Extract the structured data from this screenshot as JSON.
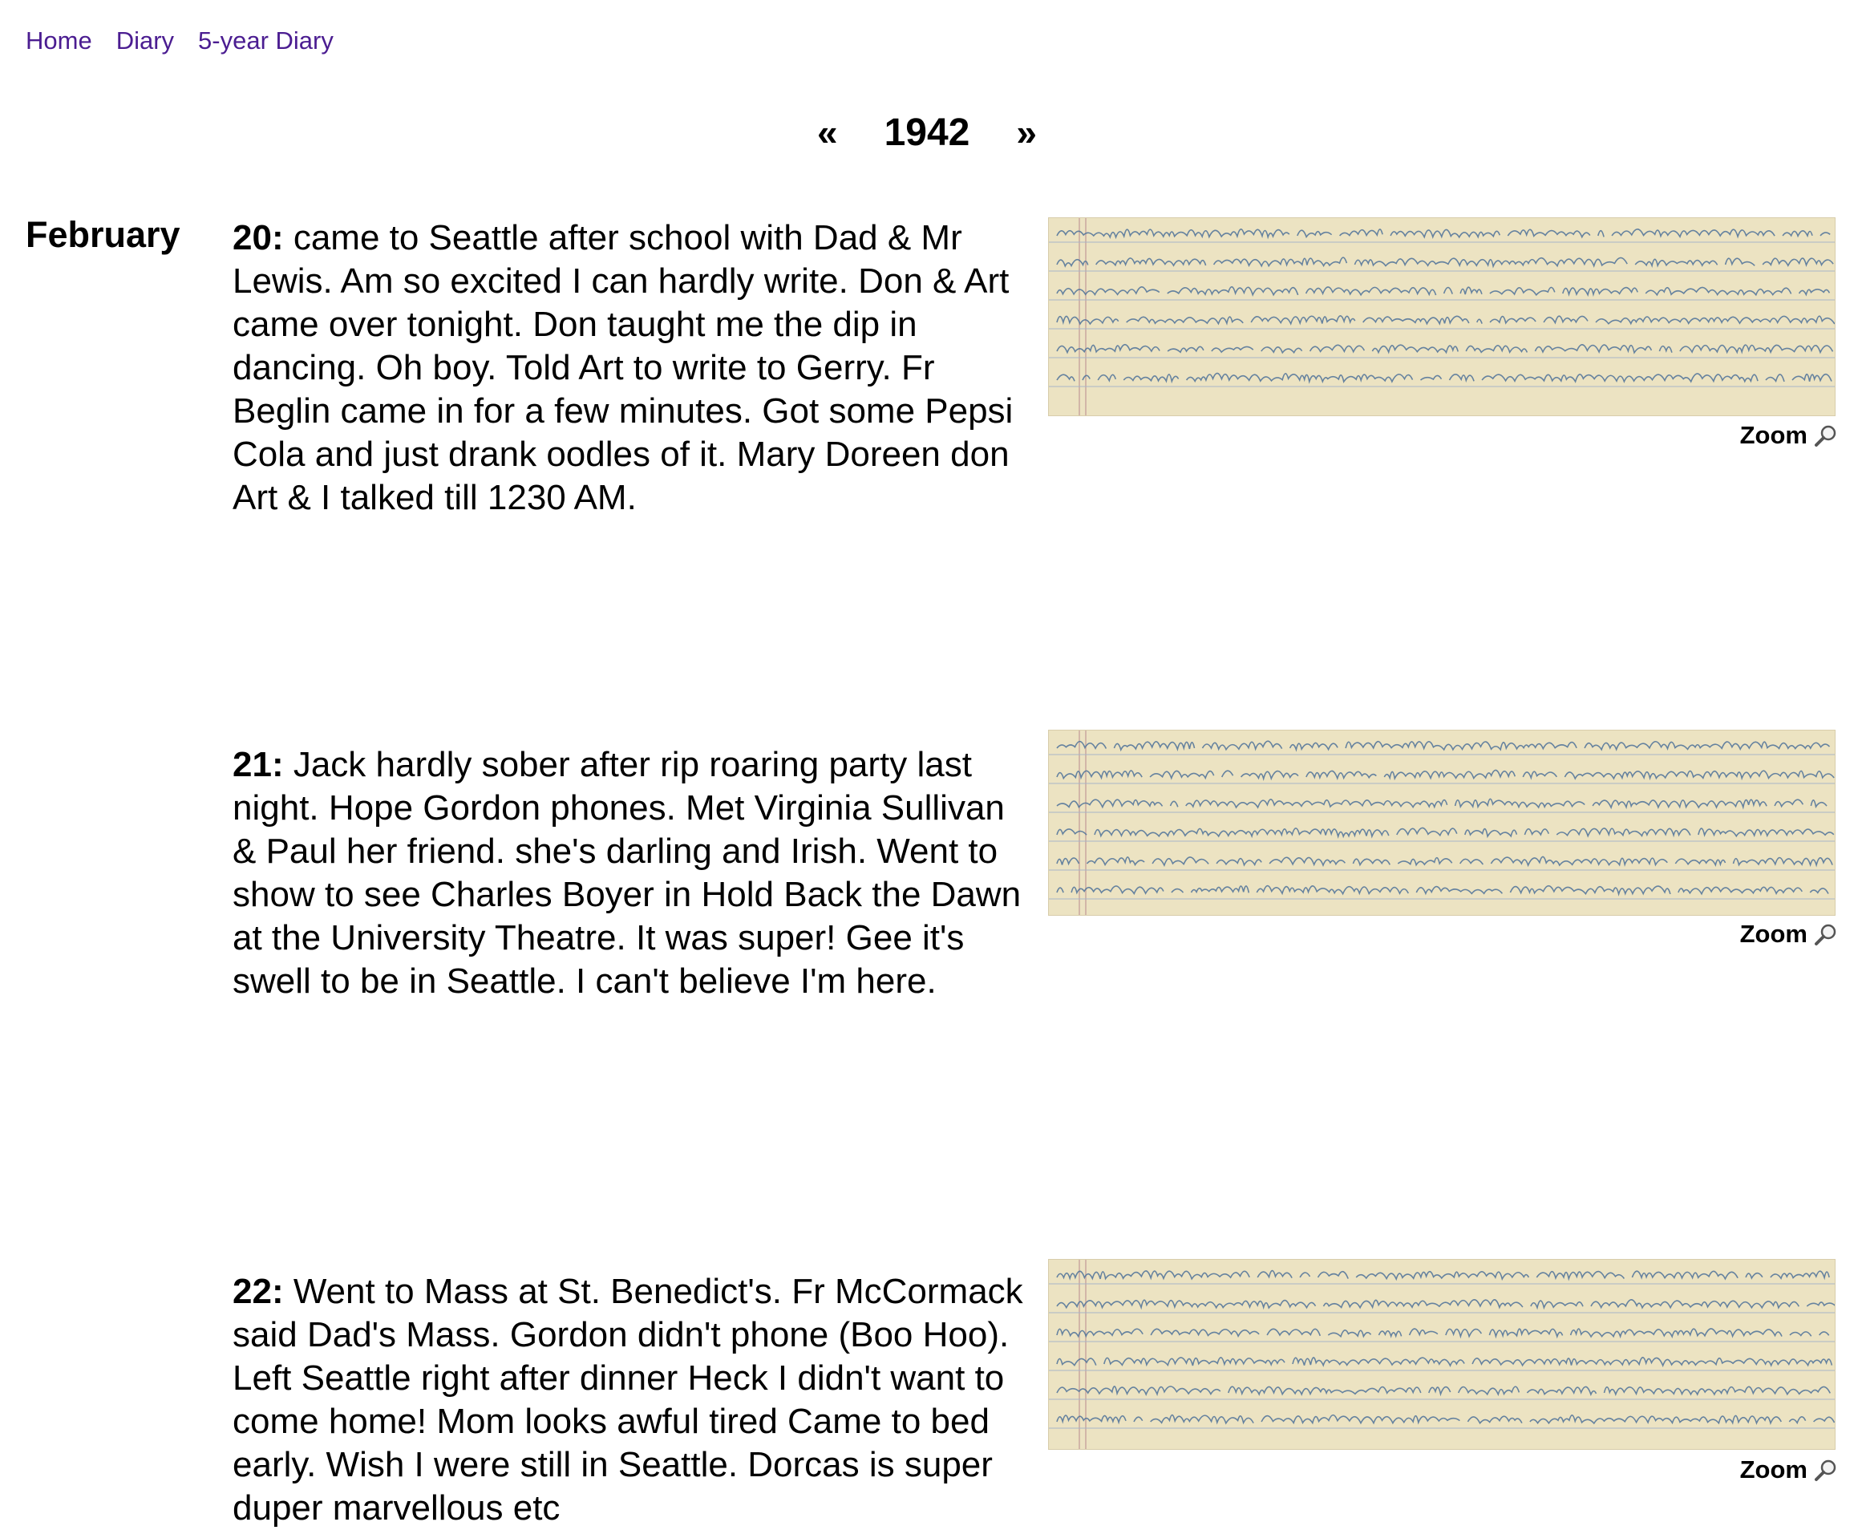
{
  "nav": {
    "home": "Home",
    "diary": "Diary",
    "five_year": "5-year Diary"
  },
  "year_nav": {
    "prev": "«",
    "year": "1942",
    "next": "»"
  },
  "month": "February",
  "entries": [
    {
      "day": "20:",
      "text": " came to Seattle after school with Dad & Mr Lewis. Am so excited I can hardly write. Don & Art came over tonight. Don taught me the dip in dancing. Oh boy. Told Art to write to Gerry. Fr Beglin came in for a few minutes. Got some Pepsi Cola and just drank oodles of it. Mary Doreen don Art & I talked till 1230 AM.",
      "zoom": "Zoom",
      "image_alt": "Handwritten diary page scan for February 20, 1942"
    },
    {
      "day": "21:",
      "text": " Jack hardly sober after rip roaring party last night. Hope Gordon phones. Met Virginia Sullivan & Paul her friend. she's darling and Irish. Went to show to see Charles Boyer in Hold Back the Dawn at the University Theatre. It was super! Gee it's swell to be in Seattle. I can't believe I'm here.",
      "zoom": "Zoom",
      "image_alt": "Handwritten diary page scan for February 21, 1942"
    },
    {
      "day": "22:",
      "text": " Went to Mass at St. Benedict's. Fr McCormack said Dad's Mass. Gordon didn't phone (Boo Hoo). Left Seattle right after dinner Heck I didn't want to come home! Mom looks awful tired Came to bed early. Wish I were still in Seattle. Dorcas is super duper marvellous etc",
      "zoom": "Zoom",
      "image_alt": "Handwritten diary page scan for February 22, 1942"
    }
  ],
  "colors": {
    "link": "#4b1d91",
    "paper": "#ece3c2",
    "ink": "#4e7199",
    "rule": "#a8b4c8"
  },
  "icons": {
    "zoom": "magnifier-icon"
  }
}
